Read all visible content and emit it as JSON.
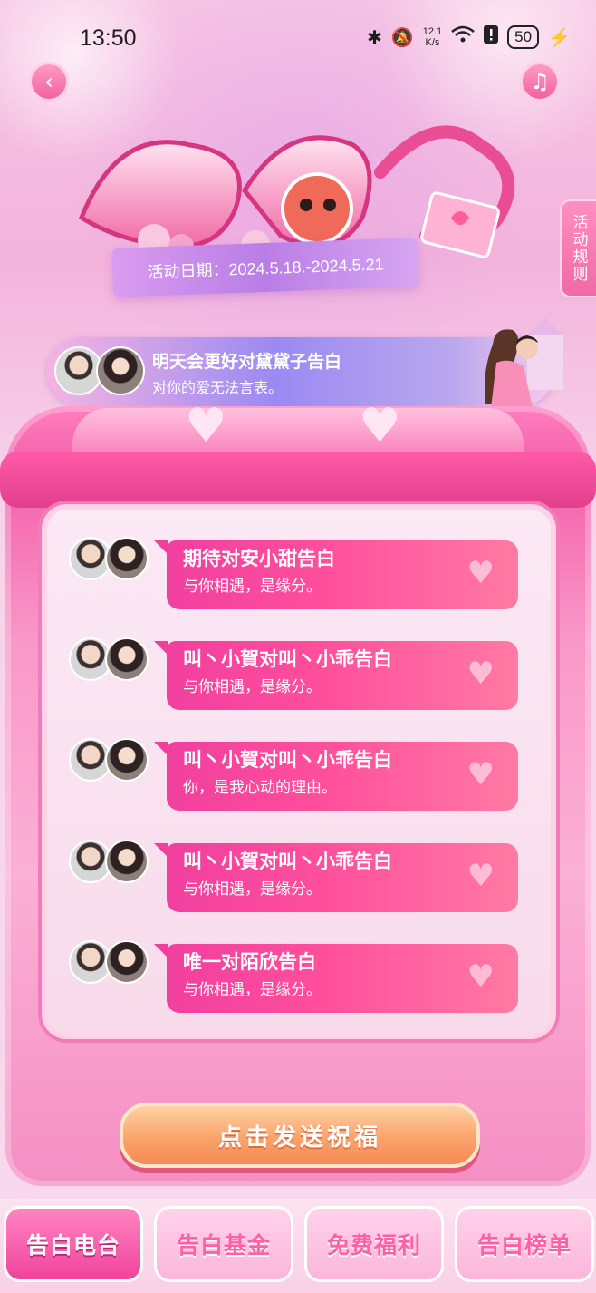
{
  "status_bar": {
    "time": "13:50",
    "speed_value": "12.1",
    "speed_unit": "K/s",
    "battery": "50",
    "icons": [
      "bluetooth-icon",
      "mute-icon",
      "wifi-icon",
      "alert-icon",
      "charging-icon"
    ]
  },
  "header": {
    "back_icon": "chevron-left-icon",
    "music_icon": "music-note-icon",
    "date_range": "活动日期：2024.5.18.-2024.5.21",
    "rules_label": "活动规则"
  },
  "banner": {
    "title": "明天会更好对黛黛子告白",
    "message": "对你的爱无法言表。"
  },
  "messages": [
    {
      "title": "期待对安小甜告白",
      "text": "与你相遇，是缘分。"
    },
    {
      "title": "叫丶小賀对叫丶小乖告白",
      "text": "与你相遇，是缘分。"
    },
    {
      "title": "叫丶小賀对叫丶小乖告白",
      "text": "你，是我心动的理由。"
    },
    {
      "title": "叫丶小賀对叫丶小乖告白",
      "text": "与你相遇，是缘分。"
    },
    {
      "title": "唯一对陌欣告白",
      "text": "与你相遇，是缘分。"
    }
  ],
  "send_button": "点击发送祝福",
  "nav": {
    "tabs": [
      {
        "label": "告白电台",
        "active": true
      },
      {
        "label": "告白基金",
        "active": false
      },
      {
        "label": "免费福利",
        "active": false
      },
      {
        "label": "告白榜单",
        "active": false
      }
    ]
  },
  "colors": {
    "accent_pink": "#f13f9f",
    "button_orange": "#fba36b",
    "banner_purple": "#9a8af2"
  }
}
